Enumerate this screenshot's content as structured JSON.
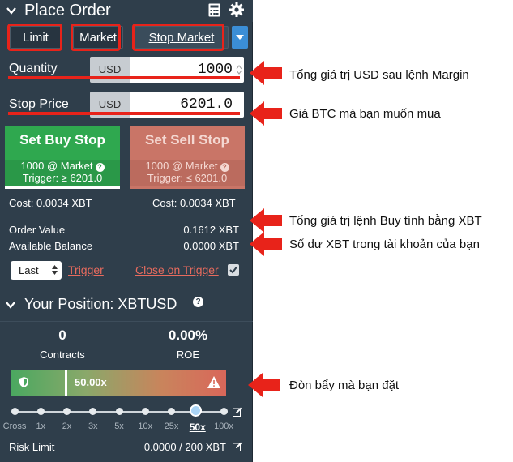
{
  "header": {
    "title": "Place Order"
  },
  "order_types": [
    "Limit",
    "Market",
    "Stop Market"
  ],
  "quantity": {
    "label": "Quantity",
    "unit": "USD",
    "value": "1000"
  },
  "stop_price": {
    "label": "Stop Price",
    "unit": "USD",
    "value": "6201.0"
  },
  "buy": {
    "title": "Set Buy Stop",
    "line1": "1000 @ Market",
    "line2": "Trigger: ≥ 6201.0",
    "cost": "Cost: 0.0034 XBT"
  },
  "sell": {
    "title": "Set Sell Stop",
    "line1": "1000 @ Market",
    "line2": "Trigger: ≤ 6201.0",
    "cost": "Cost: 0.0034 XBT"
  },
  "order_value": {
    "label": "Order Value",
    "value": "0.1612 XBT"
  },
  "available_balance": {
    "label": "Available Balance",
    "value": "0.0000 XBT"
  },
  "trigger": {
    "select_value": "Last",
    "trigger_link": "Trigger",
    "close_link": "Close on Trigger",
    "close_checked": true
  },
  "position": {
    "title": "Your Position: XBTUSD",
    "contracts_value": "0",
    "contracts_label": "Contracts",
    "roe_value": "0.00%",
    "roe_label": "ROE",
    "leverage_label": "50.00x",
    "leverage_ticks": [
      "Cross",
      "1x",
      "2x",
      "3x",
      "5x",
      "10x",
      "25x",
      "50x",
      "100x"
    ],
    "leverage_selected": "50x",
    "risk_limit_label": "Risk Limit",
    "risk_limit_value": "0.0000 / 200 XBT"
  },
  "annotations": {
    "quantity": "Tổng giá trị USD sau lệnh Margin",
    "stop_price": "Giá BTC mà bạn muốn mua",
    "order_value": "Tổng giá trị lệnh Buy tính bằng XBT",
    "balance": "Số dư XBT trong tài khoản của bạn",
    "leverage": "Đòn bẩy mà bạn đặt"
  },
  "colors": {
    "panel": "#2f3e4b",
    "buy": "#2fa84f",
    "sell": "#c97567",
    "annotation": "#e8231a",
    "accent": "#3b8ed6"
  }
}
